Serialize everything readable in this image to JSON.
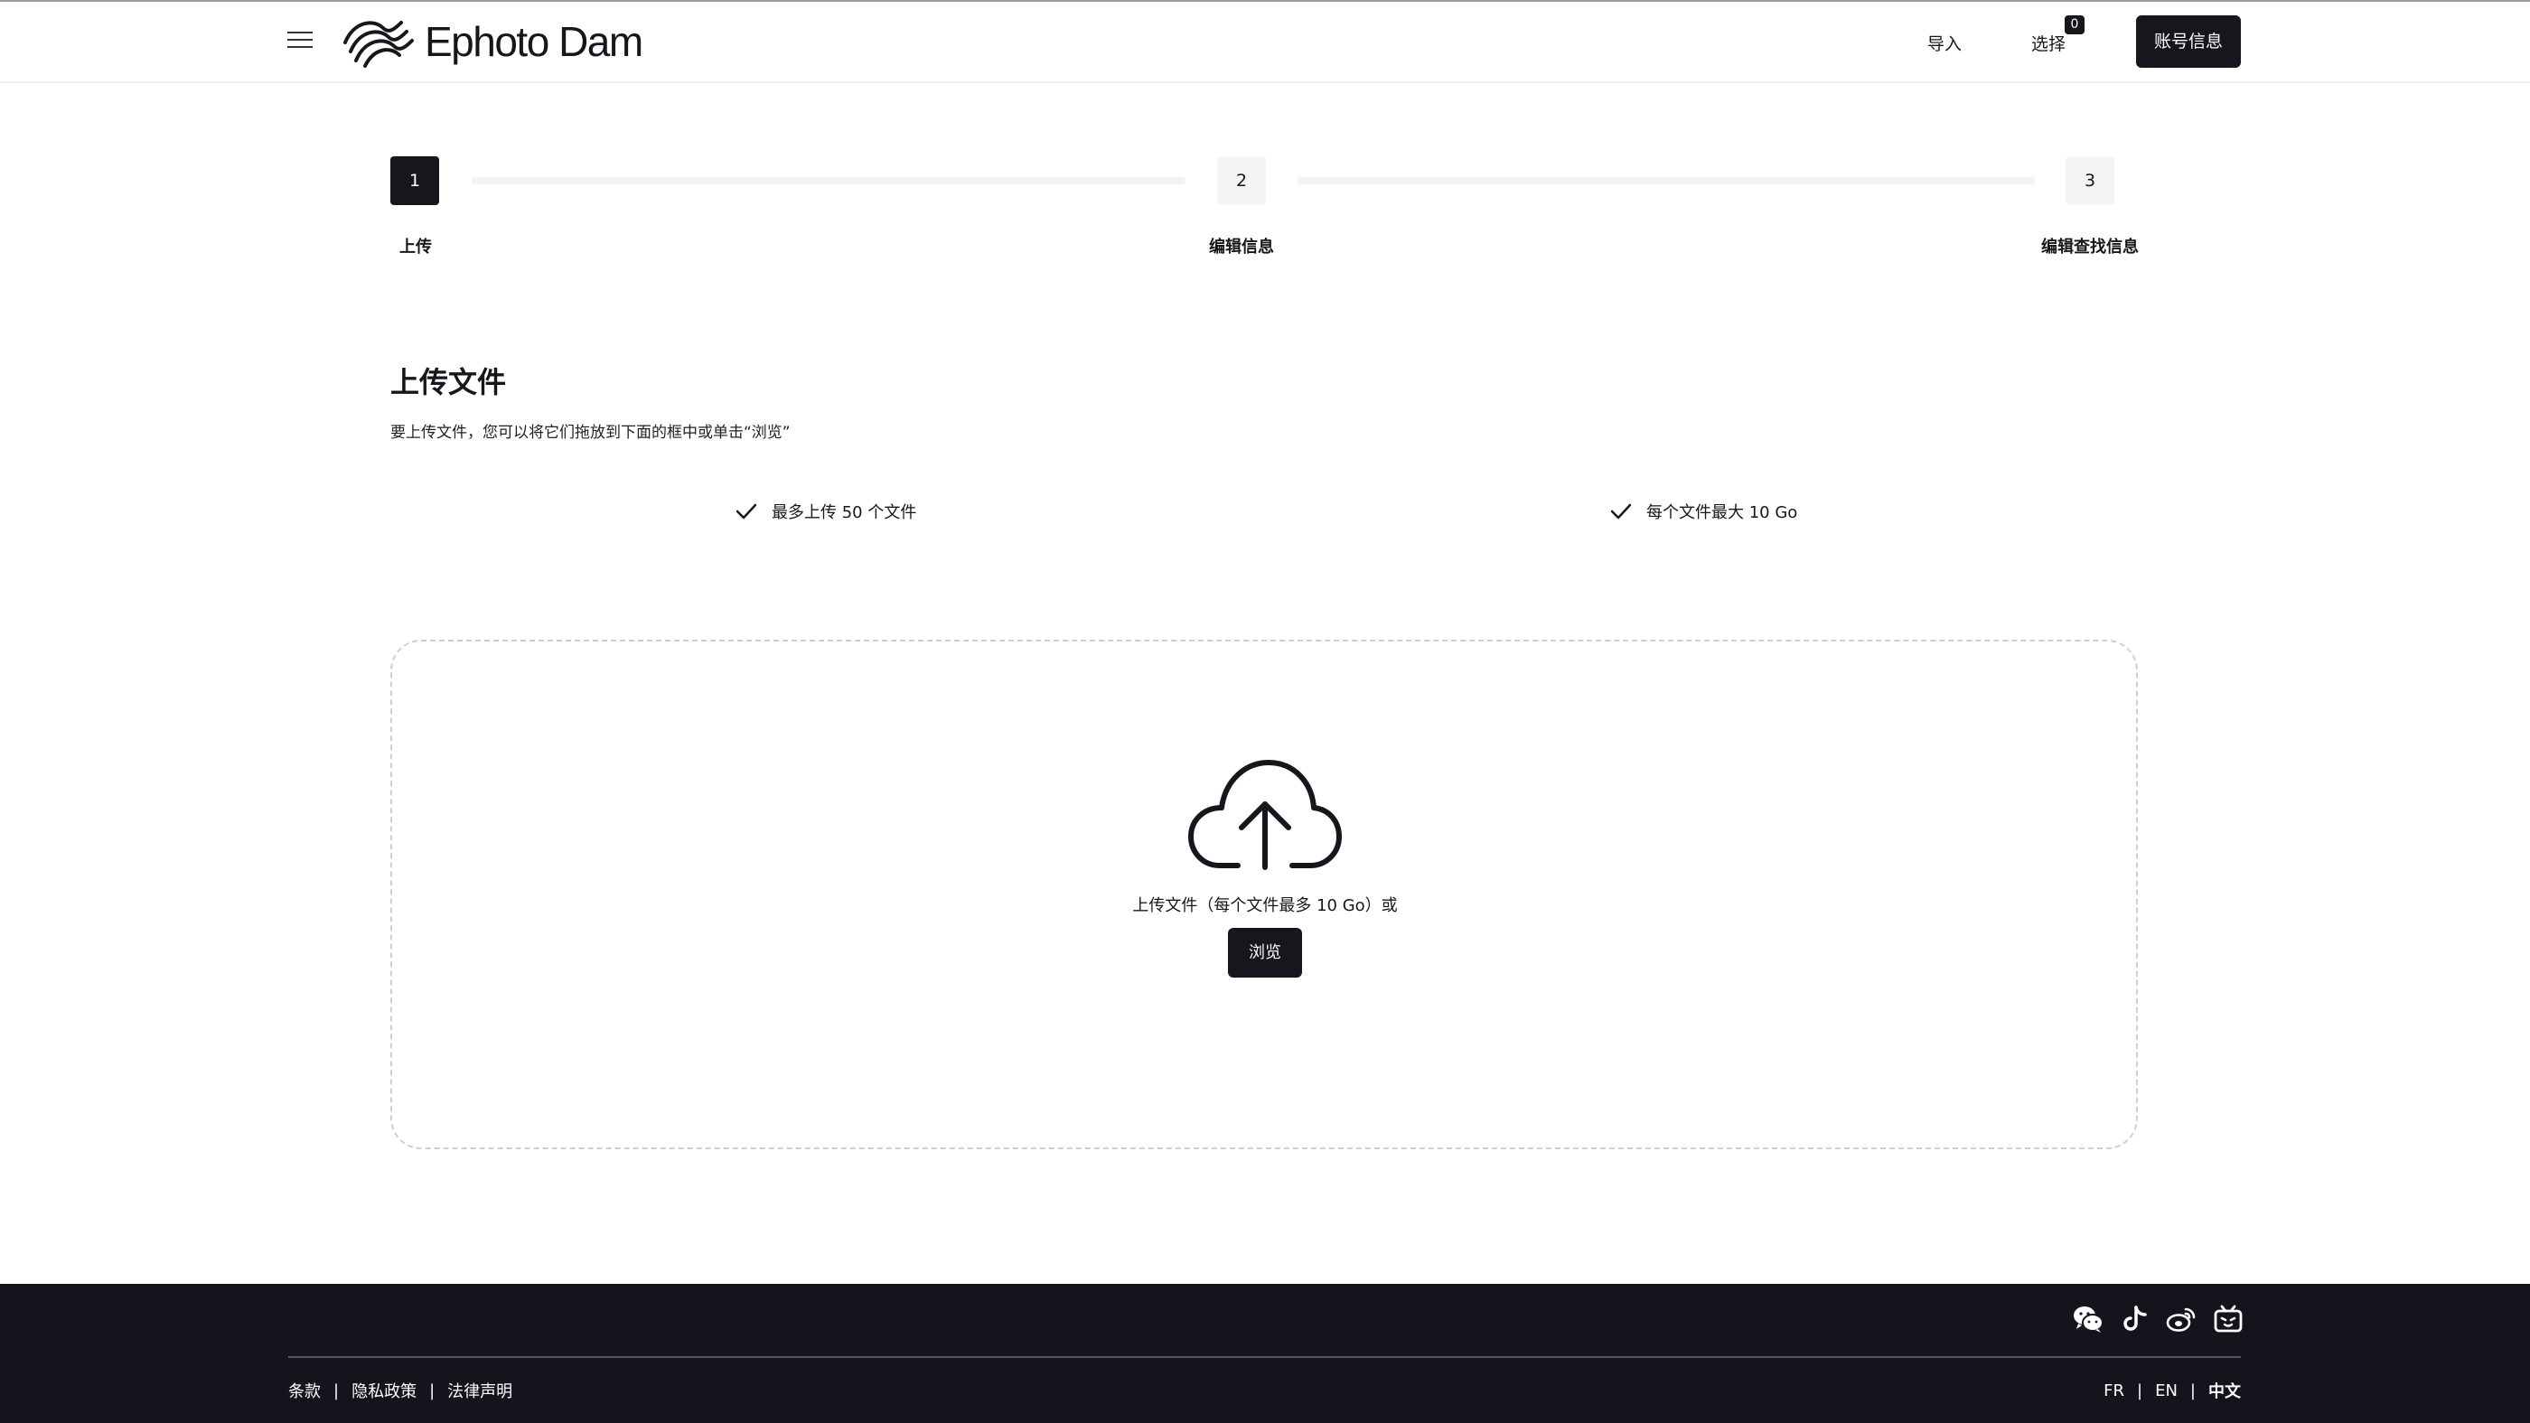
{
  "header": {
    "logo_text": "Ephoto Dam",
    "nav_import": "导入",
    "nav_select": "选择",
    "selection_count": "0",
    "account_button": "账号信息"
  },
  "stepper": {
    "steps": [
      {
        "number": "1",
        "label": "上传",
        "state": "active"
      },
      {
        "number": "2",
        "label": "编辑信息",
        "state": "inactive"
      },
      {
        "number": "3",
        "label": "编辑查找信息",
        "state": "inactive"
      }
    ]
  },
  "upload": {
    "title": "上传文件",
    "description": "要上传文件，您可以将它们拖放到下面的框中或单击“浏览”",
    "features": [
      "最多上传 50 个文件",
      "每个文件最大 10 Go"
    ],
    "drop_text": "上传文件（每个文件最多 10 Go）或",
    "browse_button": "浏览"
  },
  "footer": {
    "social_icons": [
      "wechat-icon",
      "tiktok-icon",
      "weibo-icon",
      "bilibili-icon"
    ],
    "links": [
      "条款",
      "隐私政策",
      "法律声明"
    ],
    "separator": "|",
    "languages": [
      "FR",
      "EN",
      "中文"
    ],
    "current_language": "中文"
  },
  "colors": {
    "primary": "#16171d",
    "footer_bg": "#13141c",
    "step_inactive_bg": "#f4f4f4"
  }
}
